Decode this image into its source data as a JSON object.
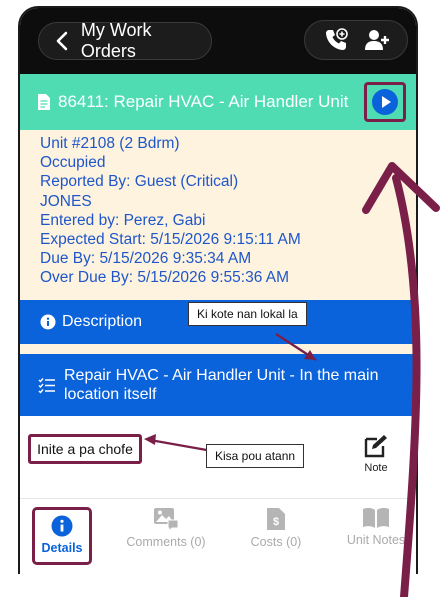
{
  "header": {
    "back_label": "My Work Orders"
  },
  "icons": {
    "back": "chevron-left-icon",
    "call": "phone-plus-icon",
    "add_user": "user-plus-icon",
    "document": "document-icon",
    "play": "play-circle-icon",
    "info": "info-circle-icon",
    "list": "list-check-icon",
    "note": "edit-note-icon",
    "details": "info-circle-icon",
    "comments": "image-comment-icon",
    "costs": "cost-document-icon",
    "unit_notes": "book-icon"
  },
  "work_order": {
    "title": "86411: Repair HVAC - Air Handler Unit"
  },
  "info": {
    "unit": "Unit #2108 (2 Bdrm)",
    "status": "Occupied",
    "reported_by": "Reported By: Guest  (Critical)",
    "reporter_name": "JONES",
    "entered_by": "Entered by: Perez, Gabi",
    "expected_start": "Expected Start: 5/15/2026 9:15:11 AM",
    "due_by": "Due By: 5/15/2026 9:35:34 AM",
    "over_due_by": "Over Due By: 5/15/2026 9:55:36 AM"
  },
  "description": {
    "label": "Description",
    "text": "Repair HVAC - Air Handler Unit - In the main location itself"
  },
  "note": {
    "value": "Inite a pa chofe",
    "button_label": "Note"
  },
  "tabs": {
    "details": "Details",
    "comments": "Comments (0)",
    "costs": "Costs (0)",
    "unit_notes": "Unit Notes"
  },
  "callouts": {
    "location": "Ki kote nan lokal la",
    "problem": "Kisa pou atann"
  },
  "colors": {
    "header": "#0d0d0d",
    "wo_bar": "#4fdcb3",
    "body": "#fdf3df",
    "accent_blue": "#0a63db",
    "info_text": "#1f56c9",
    "highlight": "#7a2048"
  }
}
